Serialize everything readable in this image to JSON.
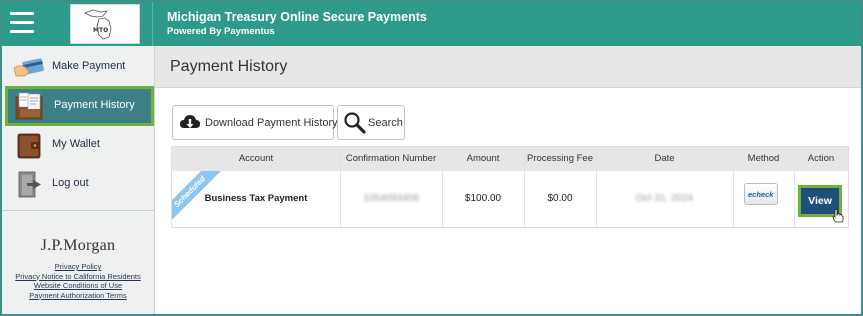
{
  "header": {
    "title": "Michigan Treasury Online Secure Payments",
    "subtitle": "Powered By Paymentus",
    "logo_text": "MTO"
  },
  "sidebar": {
    "items": [
      {
        "label": "Make Payment",
        "icon": "credit-card-hand-icon"
      },
      {
        "label": "Payment History",
        "icon": "documents-icon",
        "active": true
      },
      {
        "label": "My Wallet",
        "icon": "wallet-icon"
      },
      {
        "label": "Log out",
        "icon": "logout-door-icon"
      }
    ],
    "brand": "J.P.Morgan",
    "links": [
      "Privacy Policy",
      "Privacy Notice to California Residents",
      "Website Conditions of Use",
      "Payment Authorization Terms"
    ]
  },
  "main": {
    "page_title": "Payment History",
    "buttons": {
      "download": "Download Payment History",
      "search": "Search"
    },
    "table": {
      "columns": [
        "Account",
        "Confirmation Number",
        "Amount",
        "Processing Fee",
        "Date",
        "Method",
        "Action"
      ],
      "rows": [
        {
          "status": "Scheduled",
          "account": "Business Tax Payment",
          "confirmation": "1054093408",
          "amount": "$100.00",
          "fee": "$0.00",
          "date": "Oct 31, 2024",
          "method": "echeck",
          "action": "View"
        }
      ]
    }
  },
  "colors": {
    "header_teal": "#2e9a8c",
    "active_nav": "#3d7f86",
    "highlight_green": "#6fb13a",
    "view_button": "#1f4f78",
    "ribbon_blue": "#8ec6ee"
  }
}
